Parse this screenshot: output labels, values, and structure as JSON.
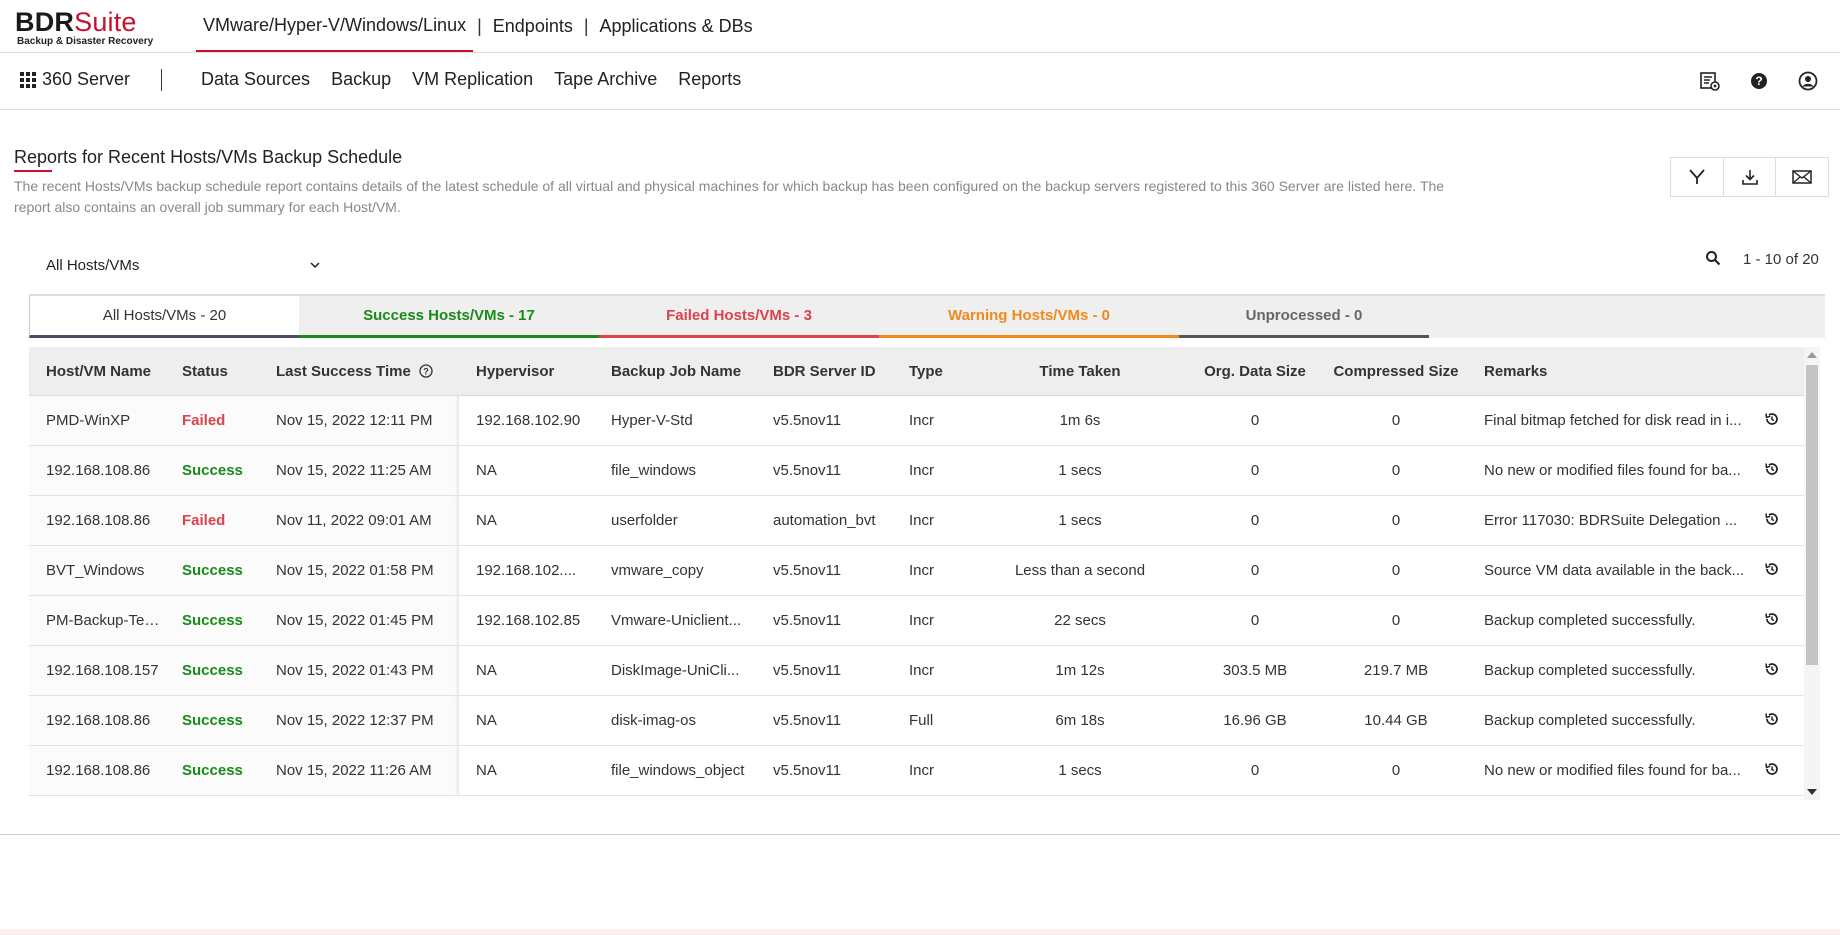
{
  "brand": {
    "name_part1": "BDR",
    "name_part2": "Suite",
    "tagline": "Backup & Disaster Recovery"
  },
  "product_nav": [
    {
      "label": "VMware/Hyper-V/Windows/Linux",
      "active": true
    },
    {
      "label": "Endpoints",
      "active": false
    },
    {
      "label": "Applications & DBs",
      "active": false
    }
  ],
  "product_nav_sep": "|",
  "subnav": {
    "app_label": "360 Server",
    "menu": [
      "Data Sources",
      "Backup",
      "VM Replication",
      "Tape Archive",
      "Reports"
    ],
    "icons": [
      "settings-list-icon",
      "help-icon",
      "user-account-icon"
    ]
  },
  "page": {
    "title": "Reports for Recent Hosts/VMs Backup Schedule",
    "description": "The recent Hosts/VMs backup schedule report contains details of the latest schedule of all virtual and physical machines for which backup has been configured on the backup servers registered to this 360 Server are listed here. The report also contains an overall job summary for each Host/VM."
  },
  "actions": [
    "filter-icon",
    "download-icon",
    "email-icon"
  ],
  "filter": {
    "selected": "All Hosts/VMs"
  },
  "pagination": {
    "range": "1 - 10 of 20"
  },
  "tabs": {
    "all": "All Hosts/VMs  -  20",
    "success": "Success Hosts/VMs  -  17",
    "failed": "Failed Hosts/VMs  -  3",
    "warning": "Warning Hosts/VMs  -  0",
    "unprocessed": "Unprocessed  -  0"
  },
  "colors": {
    "accent": "#c8102e",
    "success": "#1a8a1a",
    "failed": "#d9434e",
    "warning": "#f08a1c"
  },
  "table": {
    "headers": {
      "host": "Host/VM Name",
      "status": "Status",
      "last_success": "Last Success Time",
      "hypervisor": "Hypervisor",
      "job": "Backup Job Name",
      "server": "BDR Server ID",
      "type": "Type",
      "time": "Time Taken",
      "org_size": "Org. Data Size",
      "comp_size": "Compressed Size",
      "remarks": "Remarks"
    },
    "rows": [
      {
        "host": "PMD-WinXP",
        "status": "Failed",
        "last": "Nov 15, 2022 12:11 PM",
        "hyp": "192.168.102.90",
        "job": "Hyper-V-Std",
        "server": "v5.5nov11",
        "type": "Incr",
        "time": "1m 6s",
        "org": "0",
        "comp": "0",
        "remarks": "Final bitmap fetched for disk read in i..."
      },
      {
        "host": "192.168.108.86",
        "status": "Success",
        "last": "Nov 15, 2022 11:25 AM",
        "hyp": "NA",
        "job": "file_windows",
        "server": "v5.5nov11",
        "type": "Incr",
        "time": "1 secs",
        "org": "0",
        "comp": "0",
        "remarks": "No new or modified files found for ba..."
      },
      {
        "host": "192.168.108.86",
        "status": "Failed",
        "last": "Nov 11, 2022 09:01 AM",
        "hyp": "NA",
        "job": "userfolder",
        "server": "automation_bvt",
        "type": "Incr",
        "time": "1 secs",
        "org": "0",
        "comp": "0",
        "remarks": "Error 117030: BDRSuite Delegation ..."
      },
      {
        "host": "BVT_Windows",
        "status": "Success",
        "last": "Nov 15, 2022 01:58 PM",
        "hyp": "192.168.102....",
        "job": "vmware_copy",
        "server": "v5.5nov11",
        "type": "Incr",
        "time": "Less than a second",
        "org": "0",
        "comp": "0",
        "remarks": "Source VM data available in the back..."
      },
      {
        "host": "PM-Backup-Test...",
        "status": "Success",
        "last": "Nov 15, 2022 01:45 PM",
        "hyp": "192.168.102.85",
        "job": "Vmware-Uniclient...",
        "server": "v5.5nov11",
        "type": "Incr",
        "time": "22 secs",
        "org": "0",
        "comp": "0",
        "remarks": "Backup completed successfully."
      },
      {
        "host": "192.168.108.157",
        "status": "Success",
        "last": "Nov 15, 2022 01:43 PM",
        "hyp": "NA",
        "job": "DiskImage-UniCli...",
        "server": "v5.5nov11",
        "type": "Incr",
        "time": "1m 12s",
        "org": "303.5 MB",
        "comp": "219.7 MB",
        "remarks": "Backup completed successfully."
      },
      {
        "host": "192.168.108.86",
        "status": "Success",
        "last": "Nov 15, 2022 12:37 PM",
        "hyp": "NA",
        "job": "disk-imag-os",
        "server": "v5.5nov11",
        "type": "Full",
        "time": "6m 18s",
        "org": "16.96 GB",
        "comp": "10.44 GB",
        "remarks": "Backup completed successfully."
      },
      {
        "host": "192.168.108.86",
        "status": "Success",
        "last": "Nov 15, 2022 11:26 AM",
        "hyp": "NA",
        "job": "file_windows_object",
        "server": "v5.5nov11",
        "type": "Incr",
        "time": "1 secs",
        "org": "0",
        "comp": "0",
        "remarks": "No new or modified files found for ba..."
      }
    ]
  }
}
